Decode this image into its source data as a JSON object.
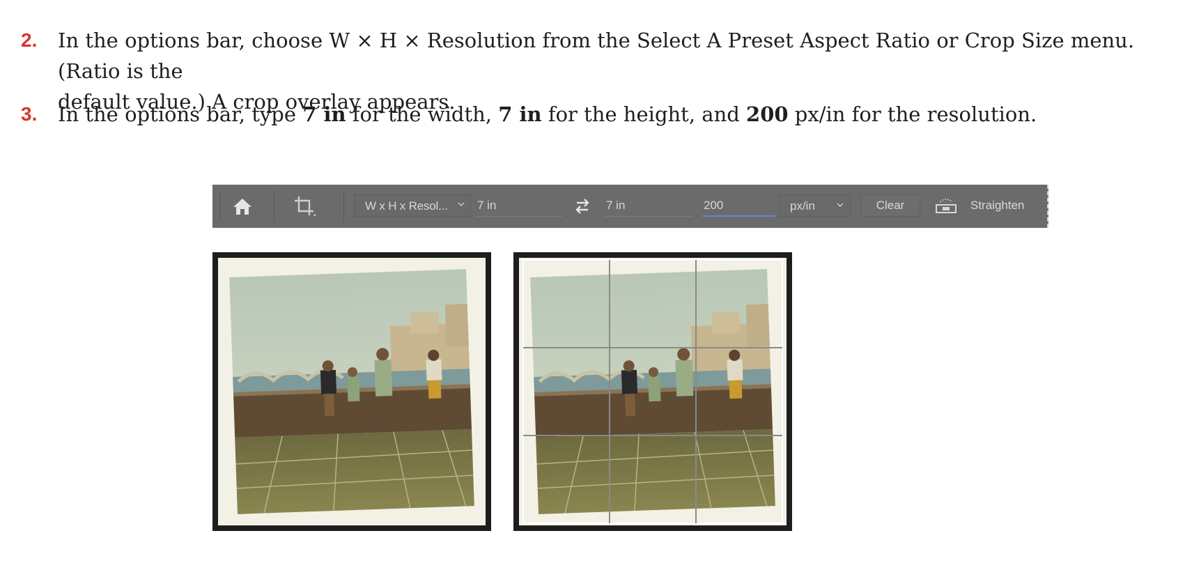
{
  "steps": [
    {
      "number": "2.",
      "line1": "In the options bar, choose W × H × Resolution from the Select A Preset Aspect Ratio or Crop Size menu. (Ratio is the",
      "line2": "default value.) A crop overlay appears."
    },
    {
      "number": "3.",
      "pre": "In the options bar, type ",
      "width_val": "7 in",
      "mid1": " for the width, ",
      "height_val": "7 in",
      "mid2": " for the height, and ",
      "res_val": "200",
      "post": " px/in for the resolution."
    }
  ],
  "options_bar": {
    "preset": "W x H x Resol...",
    "width": "7 in",
    "height": "7 in",
    "resolution": "200",
    "unit": "px/in",
    "clear_label": "Clear",
    "straighten_label": "Straighten",
    "icons": [
      "home-icon",
      "crop-tool-icon",
      "chevron-down-icon",
      "swap-icon",
      "level-icon"
    ]
  },
  "colors": {
    "step_number": "#d9362b",
    "options_bar_bg": "#6b6b6b",
    "active_field_underline": "#5f86c9"
  }
}
